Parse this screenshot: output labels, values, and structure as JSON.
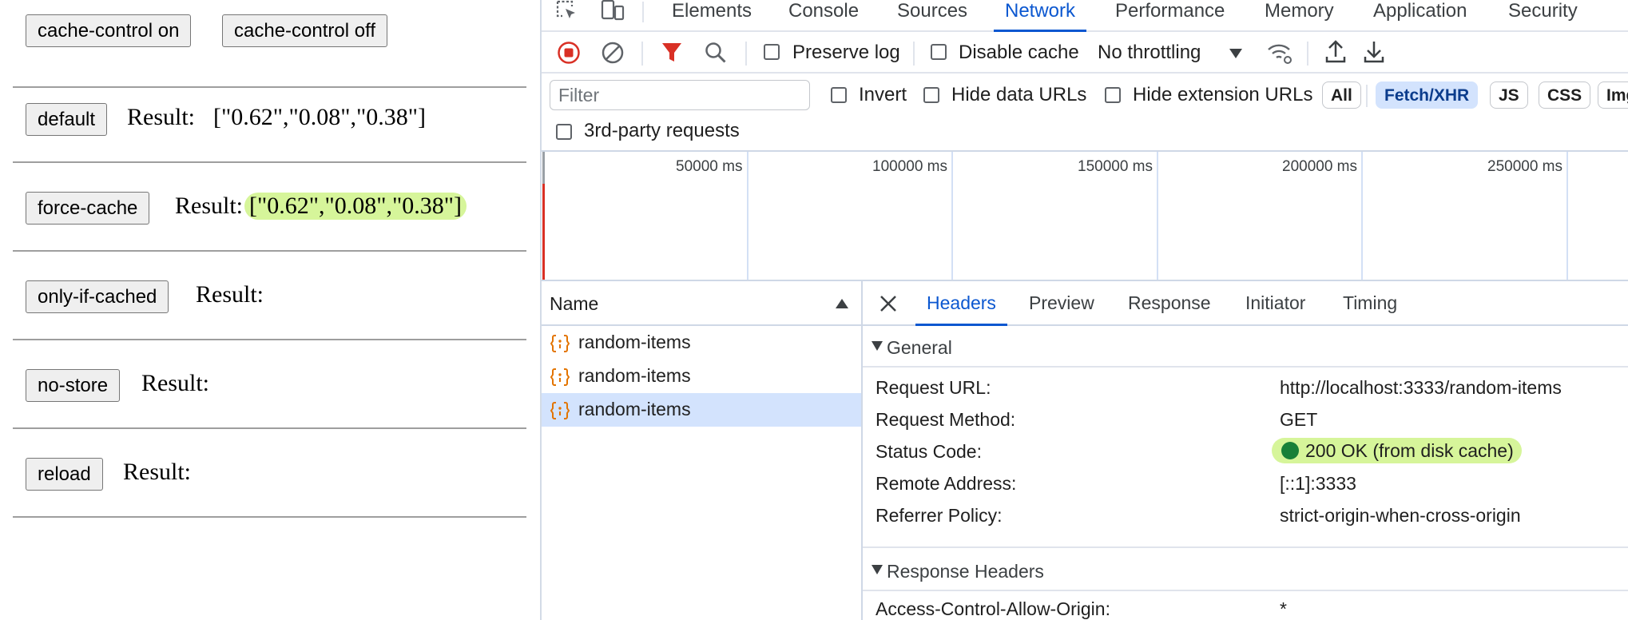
{
  "page": {
    "top_buttons": [
      "cache-control on",
      "cache-control off"
    ],
    "result_label": "Result:",
    "rows": [
      {
        "button": "default",
        "result": "[\"0.62\",\"0.08\",\"0.38\"]"
      },
      {
        "button": "force-cache",
        "result": "[\"0.62\",\"0.08\",\"0.38\"]"
      },
      {
        "button": "only-if-cached",
        "result": ""
      },
      {
        "button": "no-store",
        "result": ""
      },
      {
        "button": "reload",
        "result": ""
      }
    ]
  },
  "devtools": {
    "tabs": [
      "Elements",
      "Console",
      "Sources",
      "Network",
      "Performance",
      "Memory",
      "Application",
      "Security"
    ],
    "active_tab": "Network",
    "toolbar": {
      "preserve_log": "Preserve log",
      "disable_cache": "Disable cache",
      "throttling": "No throttling"
    },
    "filter": {
      "placeholder": "Filter",
      "invert": "Invert",
      "hide_data_urls": "Hide data URLs",
      "hide_extension_urls": "Hide extension URLs",
      "chips": [
        "All",
        "Fetch/XHR",
        "JS",
        "CSS",
        "Img"
      ],
      "active_chip": "Fetch/XHR",
      "third_party": "3rd-party requests"
    },
    "timeline": {
      "ticks": [
        "50000 ms",
        "100000 ms",
        "150000 ms",
        "200000 ms",
        "250000 ms"
      ]
    },
    "requests": {
      "column": "Name",
      "items": [
        "random-items",
        "random-items",
        "random-items"
      ],
      "selected_index": 2
    },
    "details": {
      "tabs": [
        "Headers",
        "Preview",
        "Response",
        "Initiator",
        "Timing"
      ],
      "active_tab": "Headers",
      "general_title": "General",
      "general": {
        "request_url_key": "Request URL:",
        "request_url": "http://localhost:3333/random-items",
        "method_key": "Request Method:",
        "method": "GET",
        "status_key": "Status Code:",
        "status": "200 OK (from disk cache)",
        "remote_key": "Remote Address:",
        "remote": "[::1]:3333",
        "referrer_key": "Referrer Policy:",
        "referrer": "strict-origin-when-cross-origin"
      },
      "response_title": "Response Headers",
      "response_headers": [
        {
          "key": "Access-Control-Allow-Origin:",
          "value": "*"
        }
      ]
    },
    "colors": {
      "accent": "#0b57d0",
      "highlight": "#d6f59a",
      "status_ok": "#188038",
      "record_red": "#d93025",
      "xhr_icon": "#e37400"
    }
  }
}
